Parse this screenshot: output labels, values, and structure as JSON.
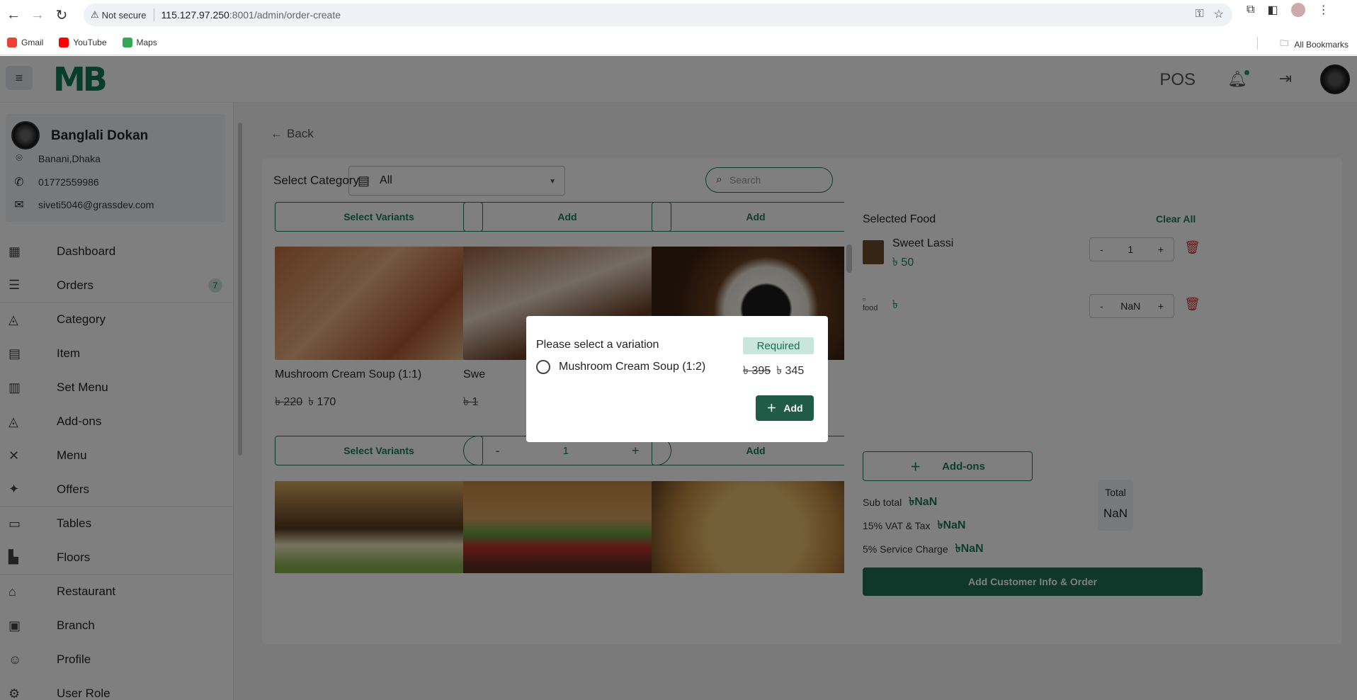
{
  "browser": {
    "not_secure": "Not secure",
    "host": "115.127.97.250",
    "path": ":8001/admin/order-create",
    "bookmarks": [
      "Gmail",
      "YouTube",
      "Maps"
    ],
    "all_bookmarks": "All Bookmarks"
  },
  "header": {
    "logo": "MB",
    "pos_label": "POS"
  },
  "shop": {
    "name": "Banglali Dokan",
    "address": "Banani,Dhaka",
    "phone": "01772559986",
    "email": "siveti5046@grassdev.com"
  },
  "sidebar": {
    "items": [
      {
        "label": "Dashboard",
        "icon": "dashboard-icon"
      },
      {
        "label": "Orders",
        "icon": "orders-icon",
        "badge": "7"
      },
      {
        "label": "Category",
        "icon": "category-icon"
      },
      {
        "label": "Item",
        "icon": "item-icon"
      },
      {
        "label": "Set Menu",
        "icon": "set-menu-icon"
      },
      {
        "label": "Add-ons",
        "icon": "addons-icon"
      },
      {
        "label": "Menu",
        "icon": "menu-icon"
      },
      {
        "label": "Offers",
        "icon": "offers-icon"
      },
      {
        "label": "Tables",
        "icon": "tables-icon"
      },
      {
        "label": "Floors",
        "icon": "floors-icon"
      },
      {
        "label": "Restaurant",
        "icon": "restaurant-icon"
      },
      {
        "label": "Branch",
        "icon": "branch-icon"
      },
      {
        "label": "Profile",
        "icon": "profile-icon"
      },
      {
        "label": "User Role",
        "icon": "user-role-icon"
      }
    ]
  },
  "main": {
    "back_label": "Back",
    "category_label": "Select Category",
    "category_value": "All",
    "search_placeholder": "Search",
    "top_buttons": [
      "Select Variants",
      "Add",
      "Add"
    ],
    "cards": [
      {
        "name": "Mushroom Cream Soup (1:1)",
        "old_price": "৳ 220",
        "price": "৳ 170",
        "button": "Select Variants"
      },
      {
        "name": "Swe",
        "old_price": "৳ 1",
        "stepper_minus": "-",
        "stepper_value": "1",
        "stepper_plus": "+"
      },
      {
        "button": "Add"
      }
    ]
  },
  "cart": {
    "title": "Selected Food",
    "clear_all": "Clear All",
    "items": [
      {
        "name": "Sweet Lassi",
        "price": "৳ 50",
        "qty": "1"
      },
      {
        "alt": "food",
        "price": "৳",
        "qty": "NaN"
      }
    ],
    "minus": "-",
    "plus": "+",
    "addons_label": "Add-ons",
    "subtotal_label": "Sub total",
    "subtotal_value": "৳NaN",
    "vat_label": "15% VAT & Tax",
    "vat_value": "৳NaN",
    "service_label": "5% Service Charge",
    "service_value": "৳NaN",
    "total_label": "Total",
    "total_value": "NaN",
    "order_button": "Add Customer Info & Order"
  },
  "modal": {
    "title": "Please select a variation",
    "required": "Required",
    "option_label": "Mushroom Cream Soup (1:2)",
    "option_old_price": "৳ 395",
    "option_price": "৳ 345",
    "add_label": "Add"
  }
}
